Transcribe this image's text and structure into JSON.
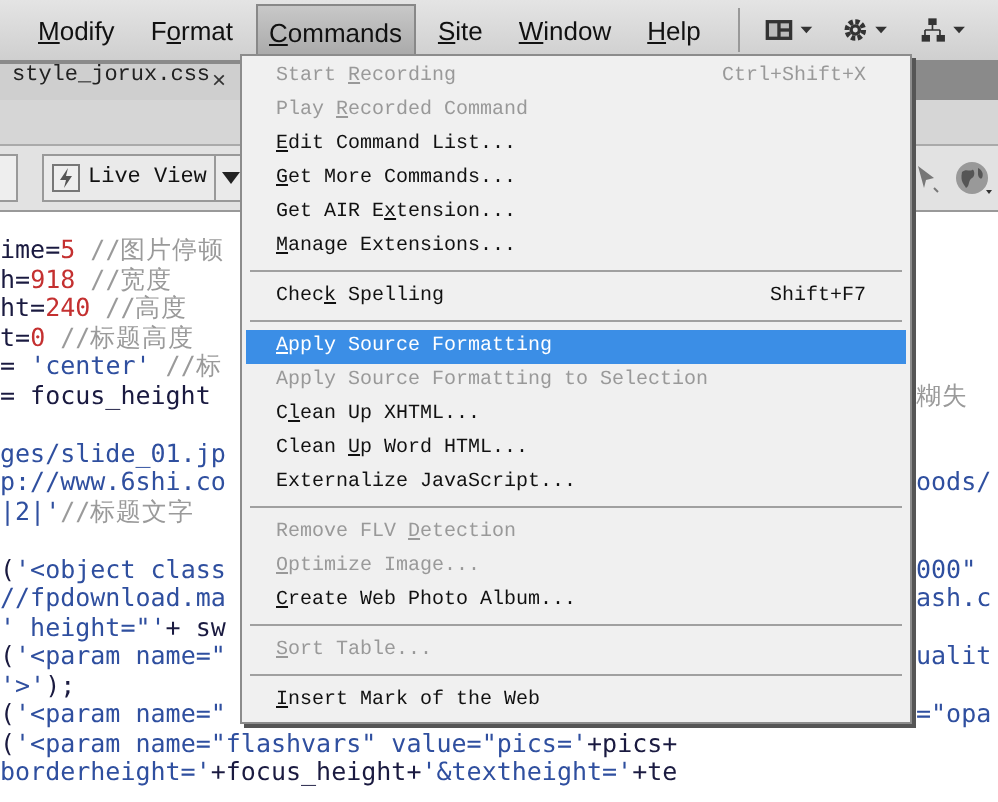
{
  "menubar": [
    {
      "label": {
        "key": "M",
        "post": "odify"
      },
      "selected": false
    },
    {
      "label": {
        "pre": "F",
        "key": "o",
        "post": "rmat"
      },
      "selected": false
    },
    {
      "label": {
        "key": "C",
        "post": "ommands"
      },
      "selected": true
    },
    {
      "label": {
        "key": "S",
        "post": "ite"
      },
      "selected": false
    },
    {
      "label": {
        "key": "W",
        "post": "indow"
      },
      "selected": false
    },
    {
      "label": {
        "key": "H",
        "post": "elp"
      },
      "selected": false
    }
  ],
  "tabs": [
    {
      "label": "style_jorux.css",
      "close": "×",
      "selected": true
    }
  ],
  "toolbar": {
    "live_view": "Live View"
  },
  "code_lines": [
    {
      "kind": "code",
      "left": [
        {
          "kind": "code",
          "text": "ime="
        },
        {
          "kind": "number",
          "text": "5"
        },
        {
          "kind": "comment",
          "text": " //图片停顿"
        }
      ]
    },
    {
      "kind": "code",
      "left": [
        {
          "kind": "code",
          "text": "h="
        },
        {
          "kind": "number",
          "text": "918"
        },
        {
          "kind": "comment",
          "text": " //宽度"
        }
      ]
    },
    {
      "kind": "code",
      "left": [
        {
          "kind": "code",
          "text": "ht="
        },
        {
          "kind": "number",
          "text": "240"
        },
        {
          "kind": "comment",
          "text": " //高度"
        }
      ]
    },
    {
      "kind": "code",
      "left": [
        {
          "kind": "code",
          "text": "t="
        },
        {
          "kind": "number",
          "text": "0"
        },
        {
          "kind": "comment",
          "text": " //标题高度"
        }
      ]
    },
    {
      "kind": "code",
      "left": [
        {
          "kind": "code",
          "text": "= "
        },
        {
          "kind": "string",
          "text": "'center'"
        },
        {
          "kind": "comment",
          "text": " //标"
        }
      ]
    },
    {
      "kind": "code",
      "left": [
        {
          "kind": "code",
          "text": " = focus_height"
        }
      ],
      "right": [
        {
          "kind": "comment",
          "text": "糊失"
        }
      ]
    },
    {
      "kind": "blank"
    },
    {
      "kind": "code",
      "left": [
        {
          "kind": "string",
          "text": "ges/slide_01.jp"
        }
      ]
    },
    {
      "kind": "code",
      "left": [
        {
          "kind": "string",
          "text": "p://www.6shi.co"
        }
      ],
      "right": [
        {
          "kind": "string",
          "text": "oods/"
        }
      ]
    },
    {
      "kind": "code",
      "left": [
        {
          "kind": "string",
          "text": "|2|'"
        },
        {
          "kind": "comment",
          "text": "//标题文字"
        }
      ]
    },
    {
      "kind": "blank"
    },
    {
      "kind": "code",
      "left": [
        {
          "kind": "code",
          "text": "("
        },
        {
          "kind": "string",
          "text": "'<object class"
        }
      ],
      "right": [
        {
          "kind": "string",
          "text": "000\""
        }
      ]
    },
    {
      "kind": "code",
      "left": [
        {
          "kind": "string",
          "text": "//fpdownload.ma"
        }
      ],
      "right": [
        {
          "kind": "string",
          "text": "ash.c"
        }
      ]
    },
    {
      "kind": "code",
      "left": [
        {
          "kind": "string",
          "text": "' height=\"'"
        },
        {
          "kind": "code",
          "text": "+ sw"
        }
      ]
    },
    {
      "kind": "code",
      "left": [
        {
          "kind": "code",
          "text": "("
        },
        {
          "kind": "string",
          "text": "'<param name=\""
        }
      ],
      "right": [
        {
          "kind": "string",
          "text": "ualit"
        }
      ]
    },
    {
      "kind": "code",
      "left": [
        {
          "kind": "string",
          "text": "'>'"
        },
        {
          "kind": "code",
          "text": ");"
        }
      ]
    },
    {
      "kind": "code",
      "left": [
        {
          "kind": "code",
          "text": "("
        },
        {
          "kind": "string",
          "text": "'<param name=\""
        }
      ],
      "right": [
        {
          "kind": "string",
          "text": "=\"opa"
        }
      ]
    },
    {
      "kind": "code",
      "left": [
        {
          "kind": "code",
          "text": "("
        },
        {
          "kind": "string",
          "text": "'<param name=\"flashvars\" value=\"pics='"
        },
        {
          "kind": "code",
          "text": "+pics+"
        }
      ]
    },
    {
      "kind": "code",
      "left": [
        {
          "kind": "string",
          "text": "borderheight='"
        },
        {
          "kind": "code",
          "text": "+focus_height+"
        },
        {
          "kind": "string",
          "text": "'&textheight='"
        },
        {
          "kind": "code",
          "text": "+te"
        }
      ]
    }
  ],
  "commands_menu": {
    "items": [
      {
        "kind": "item",
        "label": {
          "pre": "Start ",
          "key": "R",
          "post": "ecording"
        },
        "shortcut": "Ctrl+Shift+X",
        "disabled": true,
        "selected": false
      },
      {
        "kind": "item",
        "label": {
          "pre": "Play ",
          "key": "R",
          "post": "ecorded Command"
        },
        "disabled": true,
        "selected": false
      },
      {
        "kind": "item",
        "label": {
          "key": "E",
          "post": "dit Command List..."
        },
        "disabled": false,
        "selected": false
      },
      {
        "kind": "item",
        "label": {
          "key": "G",
          "post": "et More Commands..."
        },
        "disabled": false,
        "selected": false
      },
      {
        "kind": "item",
        "label": {
          "pre": "Get AIR E",
          "key": "x",
          "post": "tension..."
        },
        "disabled": false,
        "selected": false
      },
      {
        "kind": "item",
        "label": {
          "key": "M",
          "post": "anage Extensions..."
        },
        "disabled": false,
        "selected": false
      },
      {
        "kind": "separator"
      },
      {
        "kind": "item",
        "label": {
          "pre": "Chec",
          "key": "k",
          "post": " Spelling"
        },
        "shortcut": "Shift+F7",
        "disabled": false,
        "selected": false
      },
      {
        "kind": "separator"
      },
      {
        "kind": "item",
        "label": {
          "key": "A",
          "post": "pply Source Formatting"
        },
        "disabled": false,
        "selected": true
      },
      {
        "kind": "item",
        "label": {
          "pre": "Apply Source Formatting to Selection"
        },
        "disabled": true,
        "selected": false
      },
      {
        "kind": "item",
        "label": {
          "pre": "C",
          "key": "l",
          "post": "ean Up XHTML..."
        },
        "disabled": false,
        "selected": false
      },
      {
        "kind": "item",
        "label": {
          "pre": "Clean ",
          "key": "U",
          "post": "p Word HTML..."
        },
        "disabled": false,
        "selected": false
      },
      {
        "kind": "item",
        "label": {
          "pre": "Externalize JavaScript..."
        },
        "disabled": false,
        "selected": false
      },
      {
        "kind": "separator"
      },
      {
        "kind": "item",
        "label": {
          "pre": "Remove FLV ",
          "key": "D",
          "post": "etection"
        },
        "disabled": true,
        "selected": false
      },
      {
        "kind": "item",
        "label": {
          "key": "O",
          "post": "ptimize Image..."
        },
        "disabled": true,
        "selected": false
      },
      {
        "kind": "item",
        "label": {
          "key": "C",
          "post": "reate Web Photo Album..."
        },
        "disabled": false,
        "selected": false
      },
      {
        "kind": "separator"
      },
      {
        "kind": "item",
        "label": {
          "key": "S",
          "post": "ort Table..."
        },
        "disabled": true,
        "selected": false
      },
      {
        "kind": "separator"
      },
      {
        "kind": "item",
        "label": {
          "key": "I",
          "post": "nsert Mark of the Web"
        },
        "disabled": false,
        "selected": false
      }
    ]
  }
}
